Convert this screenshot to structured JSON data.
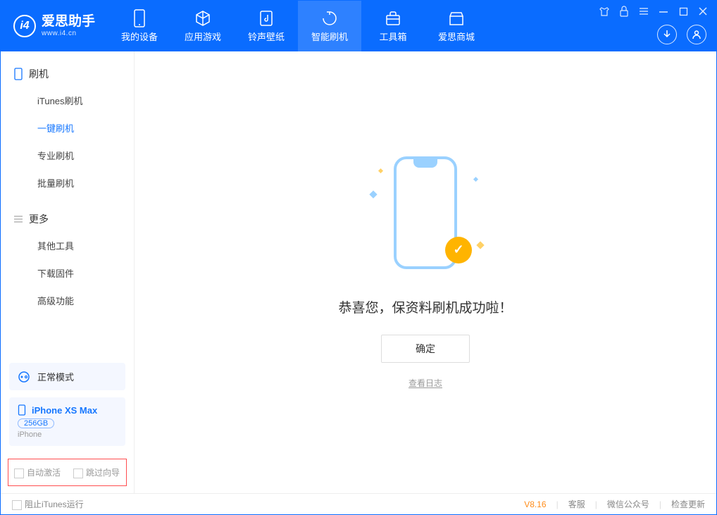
{
  "app": {
    "title": "爱思助手",
    "subtitle": "www.i4.cn"
  },
  "navtabs": [
    {
      "label": "我的设备"
    },
    {
      "label": "应用游戏"
    },
    {
      "label": "铃声壁纸"
    },
    {
      "label": "智能刷机"
    },
    {
      "label": "工具箱"
    },
    {
      "label": "爱思商城"
    }
  ],
  "sidebar": {
    "group1": "刷机",
    "items1": [
      {
        "label": "iTunes刷机"
      },
      {
        "label": "一键刷机"
      },
      {
        "label": "专业刷机"
      },
      {
        "label": "批量刷机"
      }
    ],
    "group2": "更多",
    "items2": [
      {
        "label": "其他工具"
      },
      {
        "label": "下载固件"
      },
      {
        "label": "高级功能"
      }
    ],
    "mode": "正常模式",
    "device": {
      "name": "iPhone XS Max",
      "capacity": "256GB",
      "type": "iPhone"
    },
    "checkbox1": "自动激活",
    "checkbox2": "跳过向导"
  },
  "main": {
    "success_message": "恭喜您，保资料刷机成功啦！",
    "ok_label": "确定",
    "view_log": "查看日志"
  },
  "footer": {
    "block_itunes": "阻止iTunes运行",
    "version": "V8.16",
    "links": [
      "客服",
      "微信公众号",
      "检查更新"
    ]
  }
}
